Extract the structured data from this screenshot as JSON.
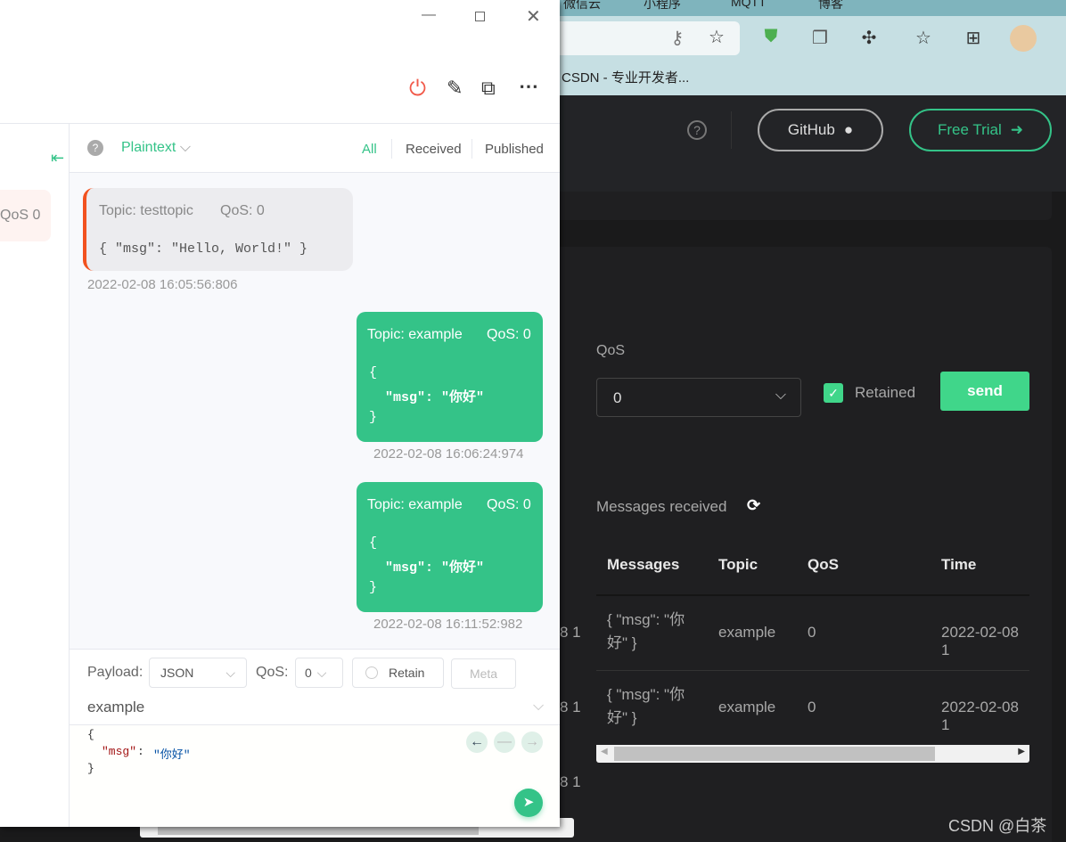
{
  "browser": {
    "tabs": [
      "微信云",
      "小程序",
      "MQTT",
      "博客"
    ],
    "bookmark": "CSDN - 专业开发者..."
  },
  "site": {
    "github": "GitHub",
    "free_trial": "Free Trial",
    "qos_label": "QoS",
    "qos_value": "0",
    "retained": "Retained",
    "send": "send",
    "messages_received": "Messages received",
    "table": {
      "headers": [
        "Messages",
        "Topic",
        "QoS",
        "Time"
      ],
      "rows": [
        {
          "msg": "{ \"msg\": \"你好\" }",
          "topic": "example",
          "qos": "0",
          "time": "2022-02-08 1"
        },
        {
          "msg": "{ \"msg\": \"你好\" }",
          "topic": "example",
          "qos": "0",
          "time": "2022-02-08 1"
        }
      ]
    },
    "left_cut": [
      "8 1",
      "8 1",
      "8 1"
    ],
    "watermark": "CSDN @白茶"
  },
  "mqttx": {
    "left_chip": "QoS 0",
    "format": "Plaintext",
    "filters": [
      "All",
      "Received",
      "Published"
    ],
    "messages": [
      {
        "dir": "in",
        "topic": "Topic: testtopic",
        "qos": "QoS: 0",
        "payload": "{ \"msg\": \"Hello, World!\" }",
        "time": "2022-02-08 16:05:56:806"
      },
      {
        "dir": "out",
        "topic": "Topic: example",
        "qos": "QoS: 0",
        "payload": [
          "{",
          "  \"msg\": \"你好\"",
          "}"
        ],
        "time": "2022-02-08 16:06:24:974"
      },
      {
        "dir": "out",
        "topic": "Topic: example",
        "qos": "QoS: 0",
        "payload": [
          "{",
          "  \"msg\": \"你好\"",
          "}"
        ],
        "time": "2022-02-08 16:11:52:982"
      }
    ],
    "compose": {
      "payload_label": "Payload:",
      "payload_type": "JSON",
      "qos_label": "QoS:",
      "qos": "0",
      "retain": "Retain",
      "meta": "Meta",
      "topic": "example",
      "editor": [
        "{",
        "\"msg\"",
        ": ",
        "\"你好\"",
        "}"
      ]
    },
    "accent": "#34c388"
  }
}
